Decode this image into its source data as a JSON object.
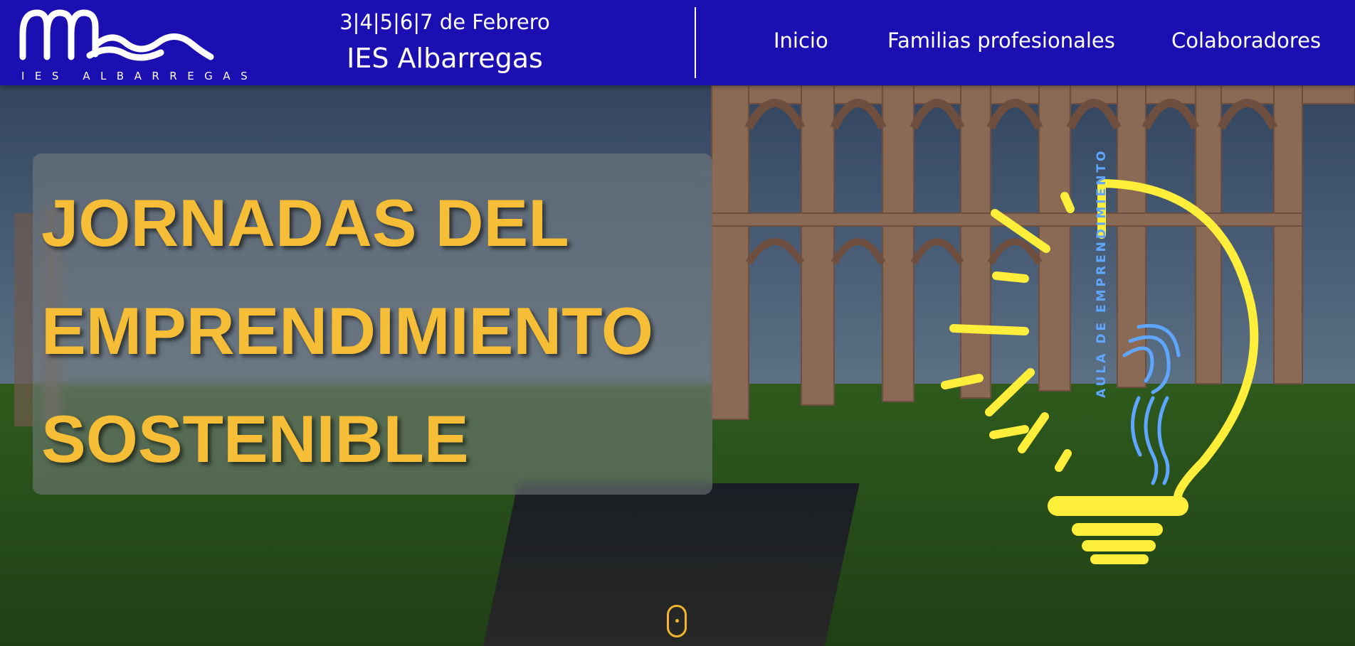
{
  "header": {
    "logo_text": "IES ALBARREGAS",
    "event_dates": "3|4|5|6|7 de Febrero",
    "event_school": "IES Albarregas",
    "nav": {
      "inicio": "Inicio",
      "familias": "Familias profesionales",
      "colaboradores": "Colaboradores"
    }
  },
  "hero": {
    "title_lines": [
      "JORNADAS DEL",
      "EMPRENDIMIENTO",
      "SOSTENIBLE"
    ],
    "bulb_label": "AULA DE EMPRENDIMIENTO"
  },
  "colors": {
    "header_bg": "#1c0fb2",
    "title_color": "#f6be36",
    "bulb_color": "#ffef3b",
    "bulb_accent": "#5ea6ff"
  },
  "icons": {
    "logo": "ies-albarregas-logo",
    "bulb": "lightbulb-icon",
    "scroll": "mouse-scroll-icon"
  }
}
